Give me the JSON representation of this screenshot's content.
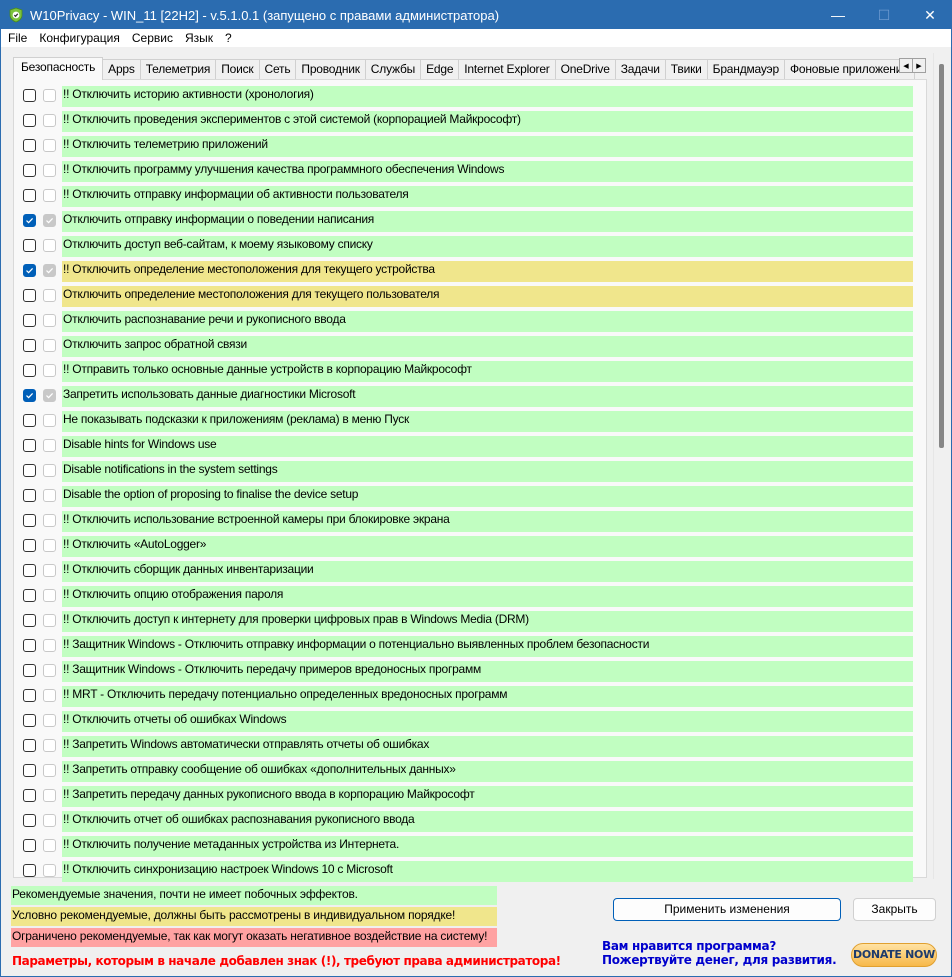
{
  "titlebar": {
    "title": "W10Privacy - WIN_11 [22H2]  - v.5.1.0.1 (запущено с правами администратора)",
    "app_icon": "shield-check-icon",
    "minimize": "—",
    "maximize": "☐",
    "close": "✕"
  },
  "menu": [
    "File",
    "Конфигурация",
    "Сервис",
    "Язык",
    "?"
  ],
  "tabs": [
    {
      "label": "Безопасность",
      "active": true
    },
    {
      "label": "Apps"
    },
    {
      "label": "Телеметрия"
    },
    {
      "label": "Поиск"
    },
    {
      "label": "Сеть"
    },
    {
      "label": "Проводник"
    },
    {
      "label": "Службы"
    },
    {
      "label": "Edge"
    },
    {
      "label": "Internet Explorer"
    },
    {
      "label": "OneDrive"
    },
    {
      "label": "Задачи"
    },
    {
      "label": "Твики"
    },
    {
      "label": "Брандмауэр"
    },
    {
      "label": "Фоновые приложения"
    }
  ],
  "tab_scroll": {
    "left": "◀",
    "right": "▶"
  },
  "options": [
    {
      "label": "!! Отключить историю активности (хронология)",
      "checked": false,
      "level": "green"
    },
    {
      "label": "!! Отключить проведения экспериментов с этой системой (корпорацией Майкрософт)",
      "checked": false,
      "level": "green"
    },
    {
      "label": "!! Отключить телеметрию приложений",
      "checked": false,
      "level": "green"
    },
    {
      "label": "!! Отключить программу улучшения качества программного обеспечения Windows",
      "checked": false,
      "level": "green"
    },
    {
      "label": "!! Отключить отправку информации об активности пользователя",
      "checked": false,
      "level": "green"
    },
    {
      "label": "Отключить отправку информации о поведении написания",
      "checked": true,
      "level": "green"
    },
    {
      "label": "Отключить доступ веб-сайтам, к моему языковому списку",
      "checked": false,
      "level": "green"
    },
    {
      "label": "!! Отключить определение местоположения для текущего устройства",
      "checked": true,
      "level": "yellow"
    },
    {
      "label": "Отключить определение местоположения для текущего пользователя",
      "checked": false,
      "level": "yellow"
    },
    {
      "label": "Отключить распознавание речи и рукописного ввода",
      "checked": false,
      "level": "green"
    },
    {
      "label": "Отключить запрос обратной связи",
      "checked": false,
      "level": "green"
    },
    {
      "label": "!! Отправить только основные данные устройств в корпорацию Майкрософт",
      "checked": false,
      "level": "green"
    },
    {
      "label": "Запретить использовать данные диагностики Microsoft",
      "checked": true,
      "level": "green"
    },
    {
      "label": "Не показывать подсказки к приложениям (реклама) в меню Пуск",
      "checked": false,
      "level": "green"
    },
    {
      "label": "Disable hints for Windows use",
      "checked": false,
      "level": "green"
    },
    {
      "label": "Disable notifications in the system settings",
      "checked": false,
      "level": "green"
    },
    {
      "label": "Disable the option of proposing to finalise the device setup",
      "checked": false,
      "level": "green"
    },
    {
      "label": "!! Отключить использование встроенной камеры при блокировке экрана",
      "checked": false,
      "level": "green"
    },
    {
      "label": "!! Отключить «AutoLogger»",
      "checked": false,
      "level": "green"
    },
    {
      "label": "!! Отключить сборщик данных инвентаризации",
      "checked": false,
      "level": "green"
    },
    {
      "label": "!! Отключить опцию отображения пароля",
      "checked": false,
      "level": "green"
    },
    {
      "label": "!! Отключить доступ к интернету для проверки цифровых прав в Windows Media (DRM)",
      "checked": false,
      "level": "green"
    },
    {
      "label": "!! Защитник Windows - Отключить отправку информации о потенциально выявленных проблем безопасности",
      "checked": false,
      "level": "green"
    },
    {
      "label": "!! Защитник Windows - Отключить передачу примеров вредоносных программ",
      "checked": false,
      "level": "green"
    },
    {
      "label": "!! MRT - Отключить передачу потенциально определенных вредоносных программ",
      "checked": false,
      "level": "green"
    },
    {
      "label": "!! Отключить отчеты об ошибках Windows",
      "checked": false,
      "level": "green"
    },
    {
      "label": "!! Запретить Windows автоматически отправлять отчеты об ошибках",
      "checked": false,
      "level": "green"
    },
    {
      "label": "!! Запретить отправку сообщение об ошибках «дополнительных данных»",
      "checked": false,
      "level": "green"
    },
    {
      "label": "!! Запретить передачу данных рукописного ввода в корпорацию Майкрософт",
      "checked": false,
      "level": "green"
    },
    {
      "label": "!! Отключить отчет об ошибках распознавания рукописного ввода",
      "checked": false,
      "level": "green"
    },
    {
      "label": "!! Отключить получение метаданных устройства из Интернета.",
      "checked": false,
      "level": "green"
    },
    {
      "label": "!! Отключить синхронизацию настроек Windows 10 с Microsoft",
      "checked": false,
      "level": "green"
    }
  ],
  "legend": [
    {
      "label": "Рекомендуемые значения, почти не имеет побочных эффектов.",
      "level": "green"
    },
    {
      "label": "Условно рекомендуемые, должны быть рассмотрены в индивидуальном порядке!",
      "level": "yellow"
    },
    {
      "label": "Ограничено рекомендуемые, так как могут оказать негативное воздействие на систему!",
      "level": "red"
    }
  ],
  "colors": {
    "green": "#c1fec1",
    "yellow": "#f0e68c",
    "red": "#ffa2a2",
    "accent": "#005fb8",
    "title": "#2b6cb0"
  },
  "admin_note": "Параметры, которым в начале добавлен знак (!), требуют права администратора!",
  "buttons": {
    "apply": "Применить изменения",
    "close": "Закрыть"
  },
  "donate": {
    "line1": "Вам нравится программа?",
    "line2": "Пожертвуйте денег, для развития.",
    "button": "DONATE NOW"
  }
}
